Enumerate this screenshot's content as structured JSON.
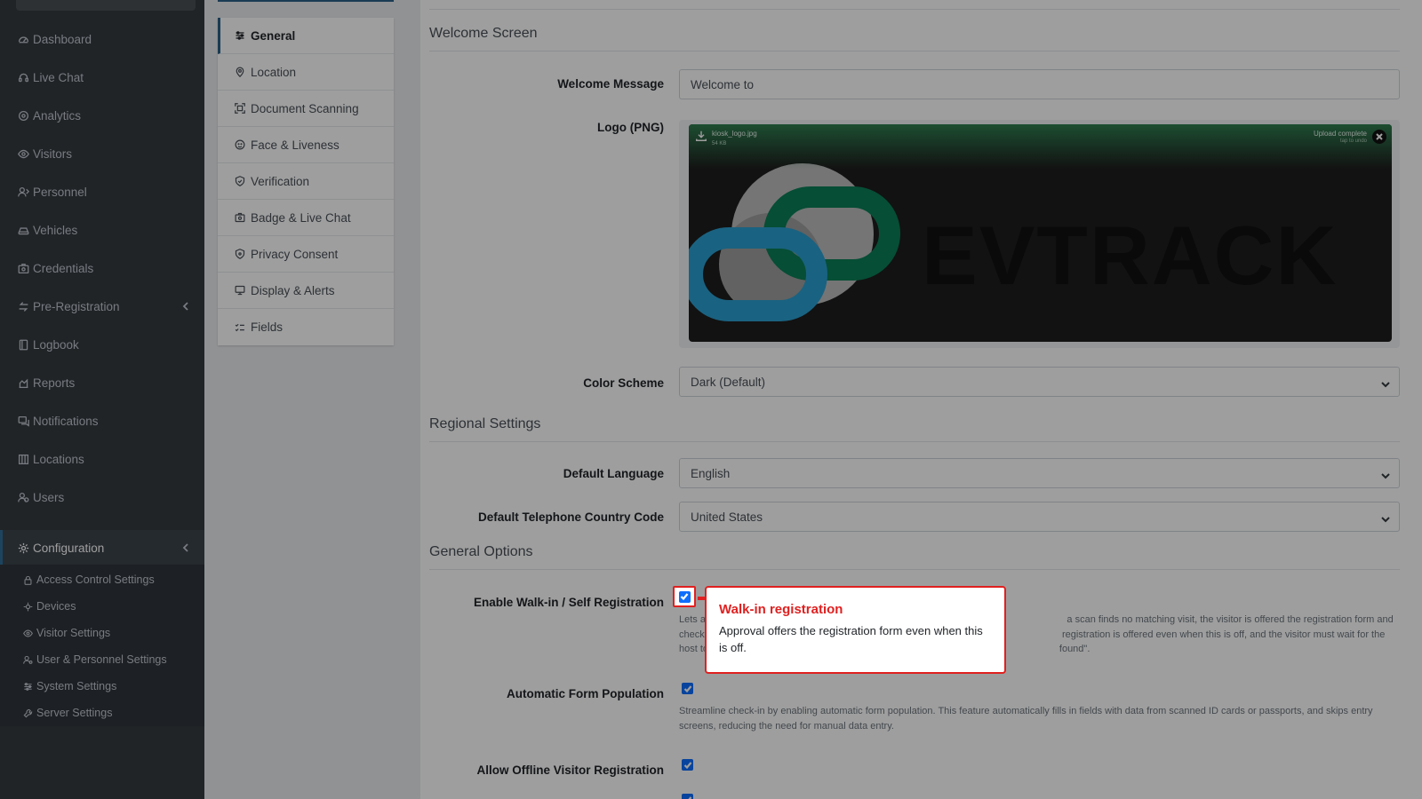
{
  "sidebar": {
    "items": [
      {
        "label": "Dashboard",
        "icon": "dashboard-icon"
      },
      {
        "label": "Live Chat",
        "icon": "headset-icon"
      },
      {
        "label": "Analytics",
        "icon": "analytics-icon"
      },
      {
        "label": "Visitors",
        "icon": "eye-icon"
      },
      {
        "label": "Personnel",
        "icon": "personnel-icon"
      },
      {
        "label": "Vehicles",
        "icon": "car-icon"
      },
      {
        "label": "Credentials",
        "icon": "id-card-icon"
      },
      {
        "label": "Pre-Registration",
        "icon": "exchange-icon"
      },
      {
        "label": "Logbook",
        "icon": "book-icon"
      },
      {
        "label": "Reports",
        "icon": "reports-icon"
      },
      {
        "label": "Notifications",
        "icon": "chat-icon"
      },
      {
        "label": "Locations",
        "icon": "building-icon"
      },
      {
        "label": "Users",
        "icon": "users-icon"
      },
      {
        "label": "Configuration",
        "icon": "gear-icon"
      }
    ],
    "sub_items": [
      {
        "label": "Access Control Settings",
        "icon": "lock-icon"
      },
      {
        "label": "Devices",
        "icon": "devices-icon"
      },
      {
        "label": "Visitor Settings",
        "icon": "eye-icon"
      },
      {
        "label": "User & Personnel Settings",
        "icon": "user-settings-icon"
      },
      {
        "label": "System Settings",
        "icon": "sliders-icon"
      },
      {
        "label": "Server Settings",
        "icon": "wrench-icon"
      }
    ]
  },
  "tabs": [
    {
      "label": "General",
      "icon": "sliders-icon"
    },
    {
      "label": "Location",
      "icon": "map-pin-icon"
    },
    {
      "label": "Document Scanning",
      "icon": "scan-icon"
    },
    {
      "label": "Face & Liveness",
      "icon": "face-icon"
    },
    {
      "label": "Verification",
      "icon": "shield-check-icon"
    },
    {
      "label": "Badge & Live Chat",
      "icon": "badge-icon"
    },
    {
      "label": "Privacy Consent",
      "icon": "shield-icon"
    },
    {
      "label": "Display & Alerts",
      "icon": "display-icon"
    },
    {
      "label": "Fields",
      "icon": "checklist-icon"
    }
  ],
  "main": {
    "welcome_section": "Welcome Screen",
    "welcome_message_label": "Welcome Message",
    "welcome_message_value": "Welcome to",
    "logo_label": "Logo (PNG)",
    "logo_file_name": "kiosk_logo.jpg",
    "logo_file_size": "54 KB",
    "logo_upload_status": "Upload complete",
    "logo_upload_hint": "tap to undo",
    "logo_text": "EVTRACK",
    "color_scheme_label": "Color Scheme",
    "color_scheme_value": "Dark (Default)",
    "regional_section": "Regional Settings",
    "default_language_label": "Default Language",
    "default_language_value": "English",
    "country_code_label": "Default Telephone Country Code",
    "country_code_value": "United States",
    "general_options_section": "General Options",
    "walkin_label": "Enable Walk-in / Self Registration",
    "walkin_help_visible": "Lets a                                                                                                                                     a scan finds no matching visit, the visitor is offered the registration form and checked in on co                                                                                                                  registration is offered even when this is off, and the visitor must wait for the host to appro                                                                                                                       found\".",
    "autofill_label": "Automatic Form Population",
    "autofill_help": "Streamline check-in by enabling automatic form population. This feature automatically fills in fields with data from scanned ID cards or passports, and skips entry screens, reducing the need for manual data entry.",
    "offline_label": "Allow Offline Visitor Registration"
  },
  "tooltip": {
    "title": "Walk-in registration",
    "body": "Approval offers the registration form even when this is off."
  },
  "colors": {
    "sidebar_bg": "#343a40",
    "accent": "#2b5f86",
    "checkbox": "#0d6efd",
    "highlight": "#e02020",
    "logo_green": "#0a7f56",
    "logo_blue": "#2a9fd0"
  }
}
